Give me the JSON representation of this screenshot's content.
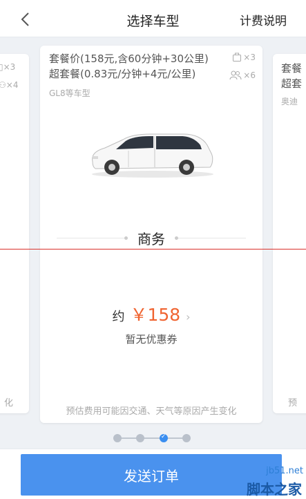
{
  "header": {
    "title": "选择车型",
    "help_label": "计费说明",
    "back_icon": "chevron-left-icon"
  },
  "cards": {
    "left": {
      "luggage": "×3",
      "passengers": "×4",
      "note_suffix": "化"
    },
    "main": {
      "package_line1": "套餐价(158元,含60分钟+30公里)",
      "package_line2": "超套餐(0.83元/分钟+4元/公里)",
      "model": "GL8等车型",
      "luggage": "×3",
      "passengers": "×6",
      "category": "商务",
      "price_prefix": "约",
      "price": "￥158",
      "coupon": "暂无优惠券",
      "note": "预估费用可能因交通、天气等原因产生变化"
    },
    "right": {
      "package_line1": "套餐",
      "package_line2": "超套",
      "model": "奥迪",
      "note_prefix": "预"
    }
  },
  "pager": {
    "count": 4,
    "active_index": 2
  },
  "submit_label": "发送订单",
  "watermark": {
    "url": "jb51.net",
    "name": "脚本之家"
  },
  "colors": {
    "accent": "#4a92ee",
    "price": "#f06431",
    "guide_line": "#d9302a"
  }
}
